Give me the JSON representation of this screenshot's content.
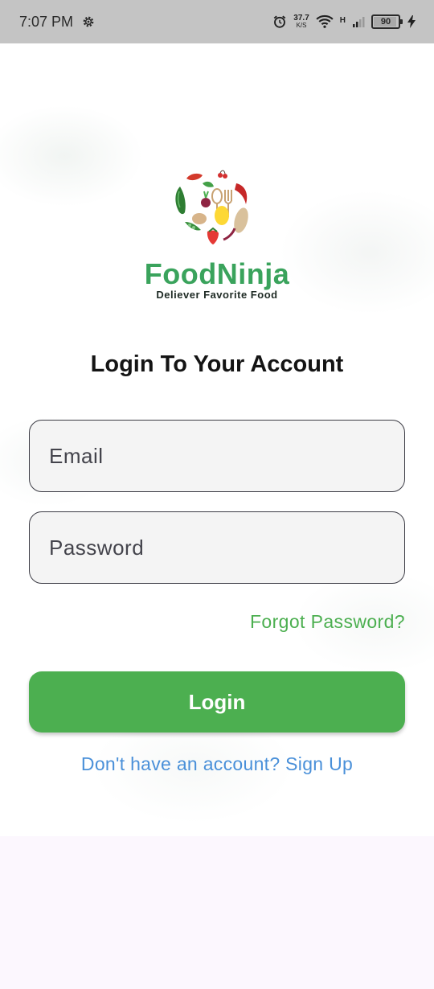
{
  "status_bar": {
    "time": "7:07 PM",
    "net_speed": "37.7",
    "net_speed_unit": "K/S",
    "network_type": "H",
    "battery_level": "90",
    "icons": [
      "gear-icon",
      "alarm-icon",
      "wifi-icon",
      "signal-icon",
      "battery-icon",
      "charging-icon"
    ]
  },
  "logo": {
    "brand_name": "FoodNinja",
    "tagline": "Deliever Favorite Food"
  },
  "login": {
    "heading": "Login To Your Account",
    "email_placeholder": "Email",
    "password_placeholder": "Password",
    "forgot_password": "Forgot Password?",
    "login_button": "Login",
    "signup_prompt": "Don't have an account? Sign Up"
  },
  "colors": {
    "accent_green": "#4caf50",
    "brand_green": "#3aa35c",
    "link_blue": "#4a90d9",
    "status_bar_bg": "#c4c4c4",
    "page_bottom_bg": "#fcf7fe"
  }
}
